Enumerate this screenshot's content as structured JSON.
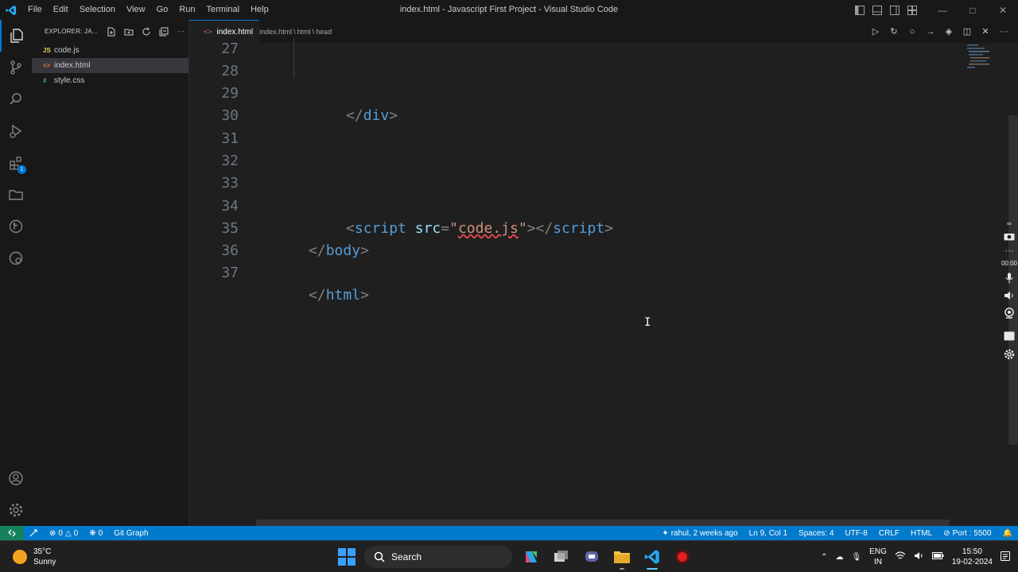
{
  "window": {
    "title": "index.html - Javascript First Project - Visual Studio Code",
    "menu": [
      "File",
      "Edit",
      "Selection",
      "View",
      "Go",
      "Run",
      "Terminal",
      "Help"
    ]
  },
  "activity_bar": {
    "extensions_badge": "1"
  },
  "explorer": {
    "header": "EXPLORER: JA...",
    "files": [
      {
        "name": "code.js",
        "icon": "JS"
      },
      {
        "name": "index.html",
        "icon": "<>"
      },
      {
        "name": "style.css",
        "icon": "#"
      }
    ]
  },
  "tab": {
    "label": "index.html",
    "breadcrumb": [
      "index.html",
      "html",
      "head"
    ]
  },
  "editor": {
    "lines": [
      {
        "num": "27"
      },
      {
        "num": "28"
      },
      {
        "num": "29"
      },
      {
        "num": "30"
      },
      {
        "num": "31"
      },
      {
        "num": "32"
      },
      {
        "num": "33"
      },
      {
        "num": "34"
      },
      {
        "num": "35"
      },
      {
        "num": "36"
      },
      {
        "num": "37"
      }
    ],
    "code": {
      "l29_open": "</",
      "l29_tag": "div",
      "l29_close": ">",
      "l34_open": "<",
      "l34_tag": "script",
      "l34_attr": "src",
      "l34_eq": "=",
      "l34_q1": "\"",
      "l34_val": "code.js",
      "l34_q2": "\"",
      "l34_mid": "></",
      "l34_tag2": "script",
      "l34_close": ">",
      "l35_open": "</",
      "l35_tag": "body",
      "l35_close": ">",
      "l37_open": "</",
      "l37_tag": "html",
      "l37_close": ">"
    }
  },
  "recorder": {
    "timer": "00:00"
  },
  "status_bar": {
    "errors": "0",
    "warnings": "0",
    "ports": "0",
    "git_graph": "Git Graph",
    "blame": "rahul, 2 weeks ago",
    "position": "Ln 9, Col 1",
    "spaces": "Spaces: 4",
    "encoding": "UTF-8",
    "eol": "CRLF",
    "language": "HTML",
    "port": "Port : 5500"
  },
  "taskbar": {
    "temperature": "35°C",
    "weather": "Sunny",
    "search_label": "Search",
    "lang_top": "ENG",
    "lang_bottom": "IN",
    "time": "15:50",
    "date": "19-02-2024"
  },
  "colors": {
    "accent": "#007acc",
    "tag": "#569cd6",
    "attribute": "#9cdcfe",
    "string": "#ce9178"
  }
}
